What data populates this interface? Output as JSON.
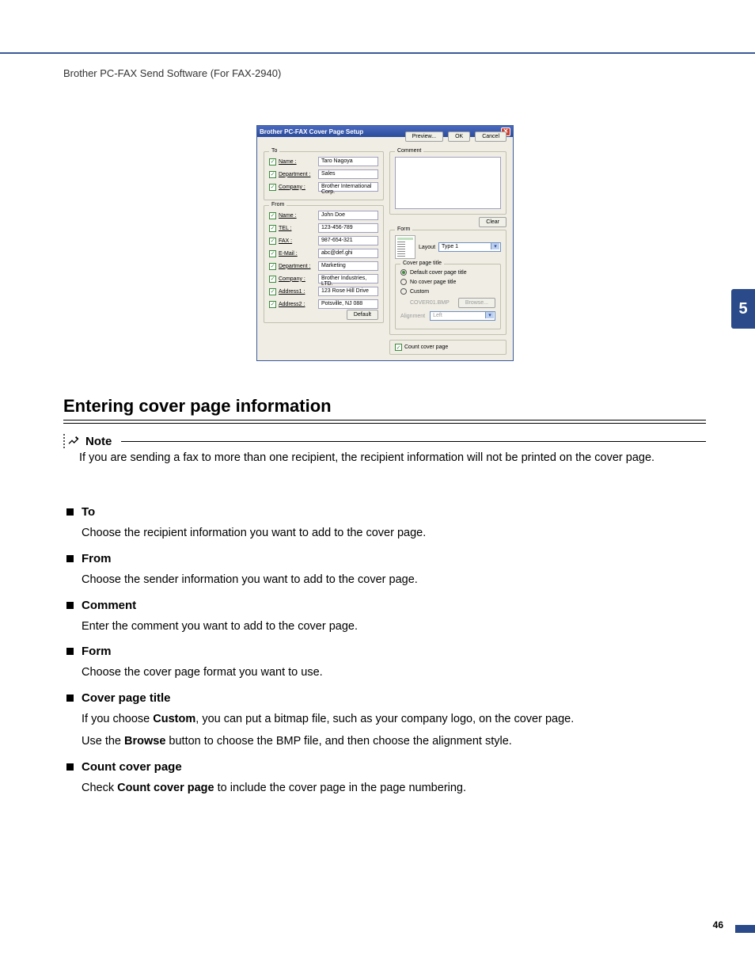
{
  "header": "Brother PC-FAX Send Software (For FAX-2940)",
  "chapter": "5",
  "page_number": "46",
  "dialog": {
    "title": "Brother PC-FAX Cover Page Setup",
    "to": {
      "legend": "To",
      "name_label": "Name :",
      "name_value": "Taro Nagoya",
      "dept_label": "Department :",
      "dept_value": "Sales",
      "company_label": "Company :",
      "company_value": "Brother International Corp."
    },
    "from": {
      "legend": "From",
      "name_label": "Name :",
      "name_value": "John Doe",
      "tel_label": "TEL :",
      "tel_value": "123-456-789",
      "fax_label": "FAX :",
      "fax_value": "987-654-321",
      "email_label": "E-Mail :",
      "email_value": "abc@def.ghi",
      "dept_label": "Department :",
      "dept_value": "Marketing",
      "company_label": "Company :",
      "company_value": "Brother Industries, LTD.",
      "addr1_label": "Address1 :",
      "addr1_value": "123 Rose Hill Drive",
      "addr2_label": "Address2 :",
      "addr2_value": "Potsville, NJ 088"
    },
    "default_btn": "Default",
    "comment_legend": "Comment",
    "clear_btn": "Clear",
    "form": {
      "legend": "Form",
      "layout_label": "Layout",
      "layout_value": "Type 1",
      "cpt_legend": "Cover page title",
      "opt_default": "Default cover page title",
      "opt_none": "No cover page title",
      "opt_custom": "Custom",
      "file_value": "COVER01.BMP",
      "browse_btn": "Browse...",
      "align_label": "Alignment",
      "align_value": "Left"
    },
    "count_label": "Count cover page",
    "preview_btn": "Preview...",
    "ok_btn": "OK",
    "cancel_btn": "Cancel"
  },
  "section_heading": "Entering cover page information",
  "note": {
    "label": "Note",
    "text": "If you are sending a fax to more than one recipient, the recipient information will not be printed on the cover page."
  },
  "items": {
    "to": {
      "head": "To",
      "body": "Choose the recipient information you want to add to the cover page."
    },
    "from": {
      "head": "From",
      "body": "Choose the sender information you want to add to the cover page."
    },
    "comment": {
      "head": "Comment",
      "body": "Enter the comment you want to add to the cover page."
    },
    "form": {
      "head": "Form",
      "body": "Choose the cover page format you want to use."
    },
    "cpt": {
      "head": "Cover page title",
      "line1_a": "If you choose ",
      "line1_b": "Custom",
      "line1_c": ", you can put a bitmap file, such as your company logo, on the cover page.",
      "line2_a": "Use the ",
      "line2_b": "Browse",
      "line2_c": " button to choose the BMP file, and then choose the alignment style."
    },
    "count": {
      "head": "Count cover page",
      "a": "Check ",
      "b": "Count cover page",
      "c": " to include the cover page in the page numbering."
    }
  }
}
